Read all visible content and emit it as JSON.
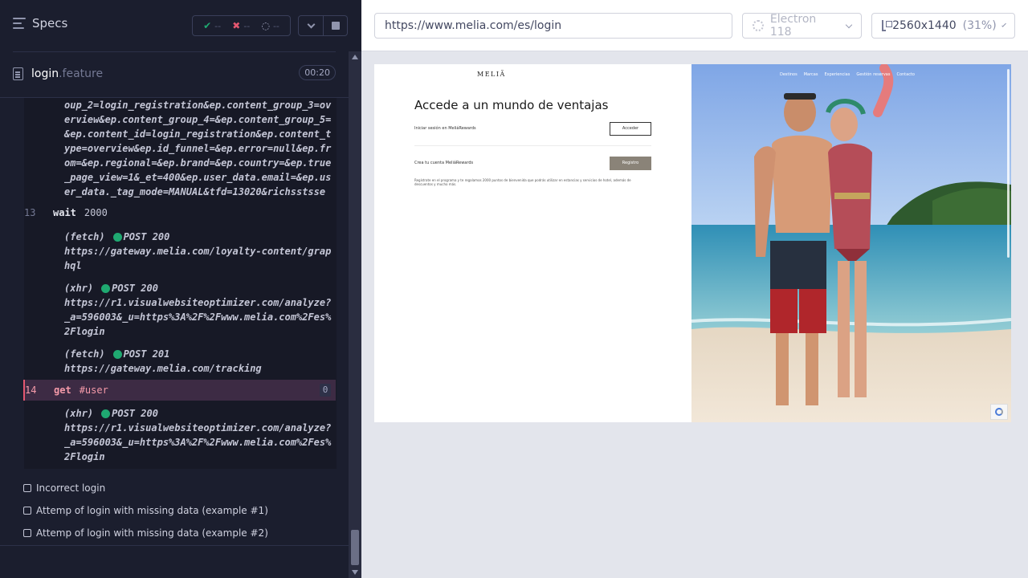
{
  "runner": {
    "title": "Specs",
    "stats": {
      "passed": "--",
      "failed": "--",
      "pending": "--"
    },
    "spec_file": {
      "name": "login",
      "extension": ".feature",
      "duration": "00:20"
    },
    "log": {
      "url_continuation": "oup_2=login_registration&ep.content_group_3=overview&ep.content_group_4=&ep.content_group_5=&ep.content_id=login_registration&ep.content_type=overview&ep.id_funnel=&ep.error=null&ep.from=&ep.regional=&ep.brand=&ep.country=&ep.true_page_view=1&_et=400&ep.user_data.email=&ep.user_data._tag_mode=MANUAL&tfd=13020&richsstsse",
      "commands": [
        {
          "number": "13",
          "name": "wait",
          "arg": "2000"
        },
        {
          "number": "14",
          "name": "get",
          "arg": "#user",
          "badge": "0"
        }
      ],
      "requests": [
        {
          "type": "(fetch)",
          "method": "POST 200",
          "url": "https://gateway.melia.com/loyalty-content/graphql"
        },
        {
          "type": "(xhr)",
          "method": "POST 200",
          "url": "https://r1.visualwebsiteoptimizer.com/analyze?_a=596003&_u=https%3A%2F%2Fwww.melia.com%2Fes%2Flogin"
        },
        {
          "type": "(fetch)",
          "method": "POST 201",
          "url": "https://gateway.melia.com/tracking"
        },
        {
          "type": "(xhr)",
          "method": "POST 200",
          "url": "https://r1.visualwebsiteoptimizer.com/analyze?_a=596003&_u=https%3A%2F%2Fwww.melia.com%2Fes%2Flogin"
        }
      ]
    },
    "tests": [
      "Incorrect login",
      "Attemp of login with missing data (example #1)",
      "Attemp of login with missing data (example #2)"
    ]
  },
  "browser": {
    "url": "https://www.melia.com/es/login",
    "name": "Electron 118",
    "viewport": "2560x1440",
    "zoom": "(31%)"
  },
  "aut": {
    "logo": "MELIÃ",
    "heading": "Accede a un mundo de ventajas",
    "login_label": "Iniciar sesión en MeliáRewards",
    "login_button": "Acceder",
    "create_label": "Crea tu cuenta MeliáRewards",
    "register_button": "Registro",
    "description": "Regístrate en el programa y te regalamos 2000 puntos de bienvenida que podrás utilizar en estancias y servicios de hotel, además de descuentos y mucho más.",
    "nav": [
      "Destinos",
      "Marcas",
      "Experiencias",
      "Gestión reservas",
      "Contacto"
    ]
  },
  "colors": {
    "pass": "#1fa971",
    "fail": "#e45770",
    "runner_bg": "#1b1e2e",
    "active_row": "#3d2b44"
  }
}
